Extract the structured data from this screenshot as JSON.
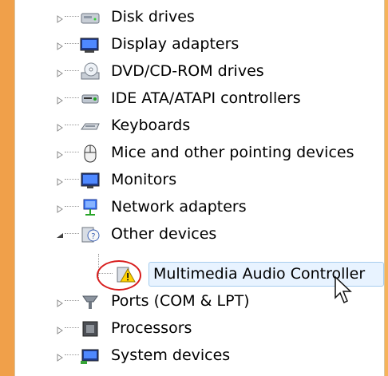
{
  "device_manager": {
    "items": [
      {
        "label": "Disk drives",
        "icon": "disk-drive-icon",
        "expanded": false
      },
      {
        "label": "Display adapters",
        "icon": "display-adapter-icon",
        "expanded": false
      },
      {
        "label": "DVD/CD-ROM drives",
        "icon": "dvd-drive-icon",
        "expanded": false
      },
      {
        "label": "IDE ATA/ATAPI controllers",
        "icon": "ide-controller-icon",
        "expanded": false
      },
      {
        "label": "Keyboards",
        "icon": "keyboard-icon",
        "expanded": false
      },
      {
        "label": "Mice and other pointing devices",
        "icon": "mouse-icon",
        "expanded": false
      },
      {
        "label": "Monitors",
        "icon": "monitor-icon",
        "expanded": false
      },
      {
        "label": "Network adapters",
        "icon": "network-adapter-icon",
        "expanded": false
      },
      {
        "label": "Other devices",
        "icon": "other-devices-icon",
        "expanded": true
      },
      {
        "label": "Multimedia Audio Controller",
        "icon": "warning-device-icon",
        "child": true,
        "selected": true
      },
      {
        "label": "Ports (COM & LPT)",
        "icon": "port-icon",
        "expanded": false
      },
      {
        "label": "Processors",
        "icon": "processor-icon",
        "expanded": false
      },
      {
        "label": "System devices",
        "icon": "system-device-icon",
        "expanded": false
      }
    ]
  },
  "colors": {
    "background_frame": "#f4a84a",
    "selection_fill": "#e8f3ff",
    "selection_border": "#a7cdee",
    "annotation_circle": "#d81d1d"
  }
}
